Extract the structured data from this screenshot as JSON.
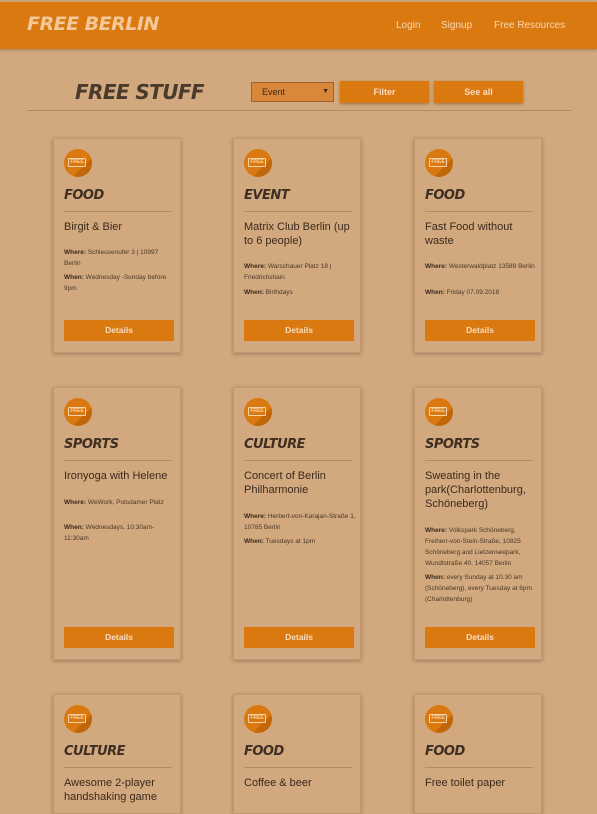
{
  "nav": {
    "brand": "FREE BERLIN",
    "login": "Login",
    "signup": "Signup",
    "free_resources": "Free Resources"
  },
  "toolbar": {
    "title": "FREE STUFF",
    "select_value": "Event",
    "filter_label": "Filter",
    "see_all_label": "See all"
  },
  "badge_text": "FREE",
  "cards": [
    {
      "category": "FOOD",
      "title": "Birgit & Bier",
      "where_label": "Where:",
      "where": "Schleusenufer 3 | 10997 Berlin",
      "when_label": "When:",
      "when": "Wednesday -Sunday before 9pm",
      "button": "Details"
    },
    {
      "category": "EVENT",
      "title": "Matrix Club Berlin (up to 6 people)",
      "where_label": "Where:",
      "where": "Warschauer Platz 18 | Friedrichshain",
      "when_label": "When:",
      "when": "Birthdays",
      "button": "Details"
    },
    {
      "category": "FOOD",
      "title": "Fast Food without waste",
      "where_label": "Where:",
      "where": "Westerwaldplatz 13589 Berlin",
      "when_label": "When:",
      "when": "Friday 07.09.2018",
      "button": "Details"
    },
    {
      "category": "SPORTS",
      "title": "Ironyoga with Helene",
      "where_label": "Where:",
      "where": "WeWork, Potsdamer Platz",
      "when_label": "When:",
      "when": "Wednesdays, 10:30am-11:30am",
      "button": "Details"
    },
    {
      "category": "CULTURE",
      "title": "Concert of Berlin Philharmonie",
      "where_label": "Where:",
      "where": "Herbert-von-Karajan-Straße 1, 10785 Berlin",
      "when_label": "When:",
      "when": "Tuesdays at 1pm",
      "button": "Details"
    },
    {
      "category": "SPORTS",
      "title": "Sweating in the park(Charlottenburg, Schöneberg)",
      "where_label": "Where:",
      "where": "Volkspark Schöneberg, Freiherr-von-Stein-Straße, 10825 Schöneberg and Lietzenseepark, Wundtstraße 40, 14057 Berlin",
      "when_label": "When:",
      "when": "every Sunday at 10.30 am (Schöneberg), every Tuesday at 6pm (Charlottenburg)",
      "button": "Details"
    },
    {
      "category": "CULTURE",
      "title": "Awesome 2-player handshaking game"
    },
    {
      "category": "FOOD",
      "title": "Coffee & beer"
    },
    {
      "category": "FOOD",
      "title": "Free toilet paper"
    }
  ]
}
